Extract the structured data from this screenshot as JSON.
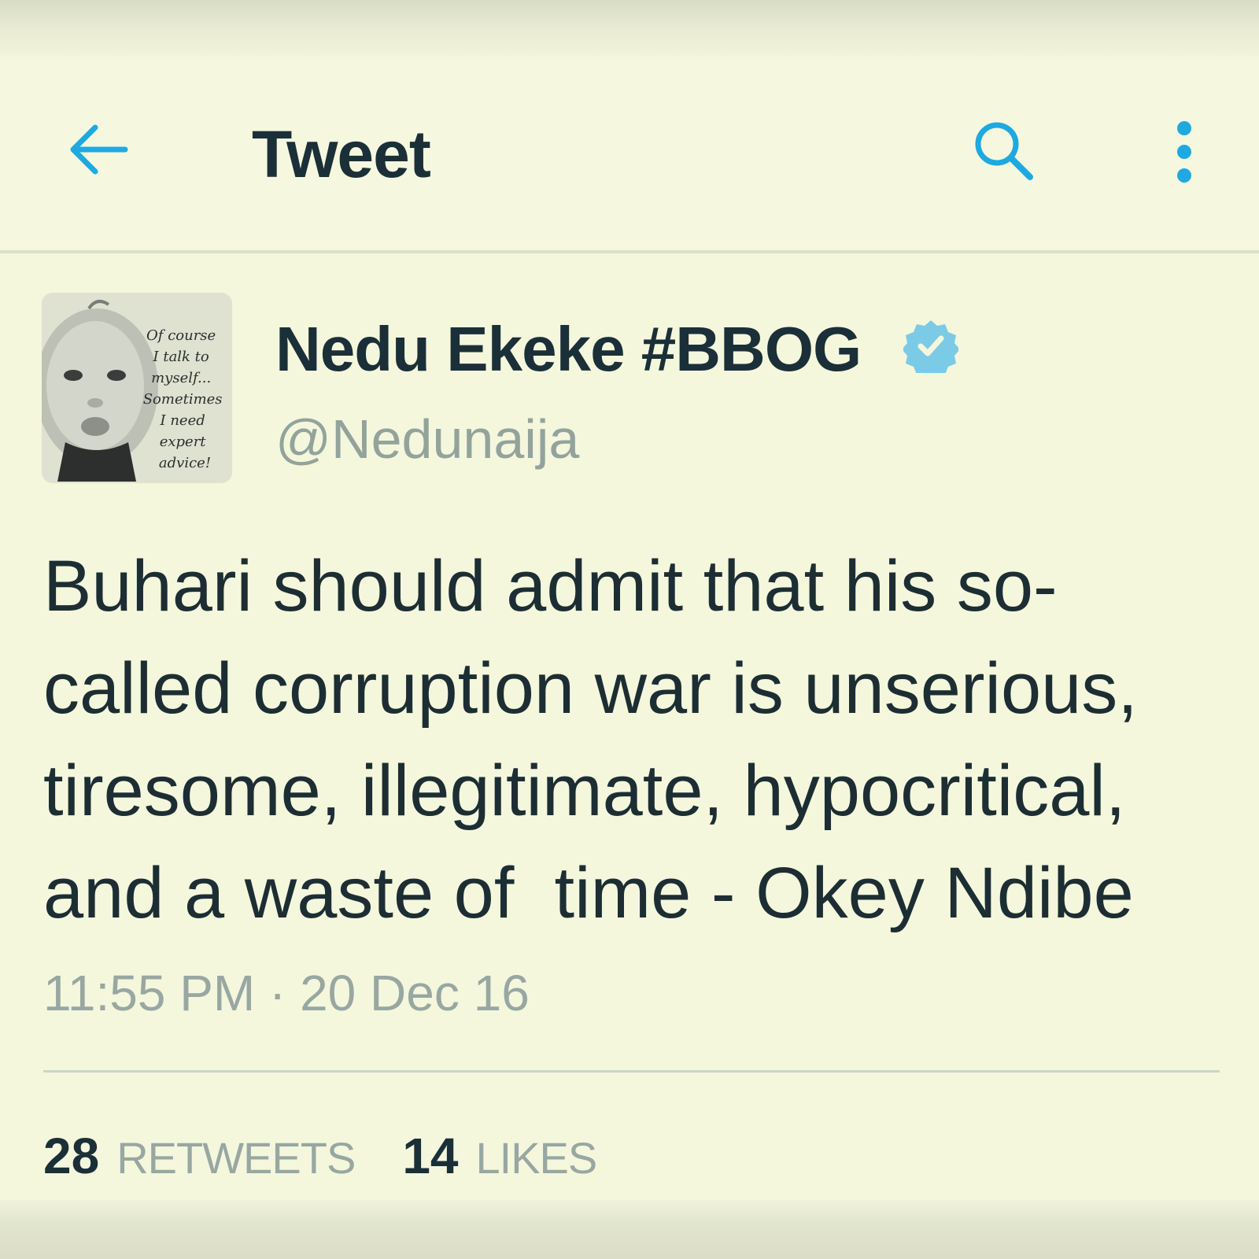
{
  "header": {
    "title": "Tweet",
    "back_icon": "arrow-left-icon",
    "search_icon": "search-icon",
    "more_icon": "more-vertical-icon"
  },
  "author": {
    "name": "Nedu Ekeke #BBOG",
    "handle": "@Nedunaija",
    "verified": true,
    "avatar_text": [
      "Of course",
      "I talk to",
      "myself...",
      "Sometimes",
      "I need",
      "expert",
      "advice!"
    ]
  },
  "tweet": {
    "text": "Buhari should admit that his so-\ncalled corruption war is unserious,\ntiresome, illegitimate, hypocritical,\nand a waste of  time - Okey Ndibe",
    "timestamp": "11:55 PM · 20 Dec 16"
  },
  "stats": {
    "retweets_count": "28",
    "retweets_label": "RETWEETS",
    "likes_count": "14",
    "likes_label": "LIKES"
  },
  "colors": {
    "background": "#f4f7dc",
    "accent": "#1fa9e1",
    "text_primary": "#1b2f38",
    "text_secondary": "#98a7a2",
    "verified": "#7ccbe6"
  }
}
